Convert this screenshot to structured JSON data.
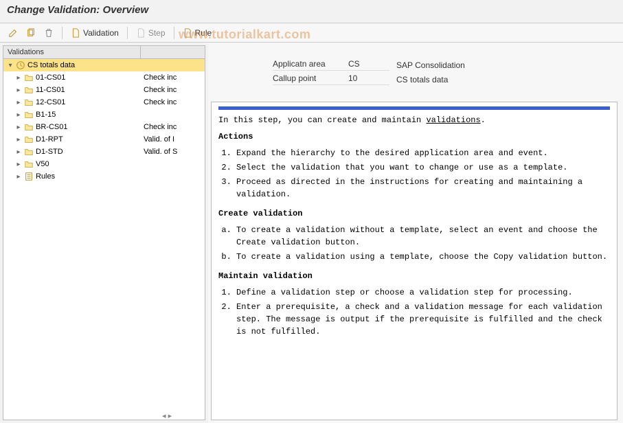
{
  "header": {
    "title": "Change Validation: Overview"
  },
  "watermark": "www.tutorialkart.com",
  "toolbar": {
    "validation_label": "Validation",
    "step_label": "Step",
    "rule_label": "Rule"
  },
  "tree": {
    "col1": "Validations",
    "col2": "",
    "root": {
      "label": "CS totals data",
      "desc": ""
    },
    "items": [
      {
        "label": "01-CS01",
        "desc": "Check inc"
      },
      {
        "label": "11-CS01",
        "desc": "Check inc"
      },
      {
        "label": "12-CS01",
        "desc": "Check inc"
      },
      {
        "label": "B1-15",
        "desc": ""
      },
      {
        "label": "BR-CS01",
        "desc": "Check inc"
      },
      {
        "label": "D1-RPT",
        "desc": "Valid. of I"
      },
      {
        "label": "D1-STD",
        "desc": "Valid. of S"
      },
      {
        "label": "V50",
        "desc": ""
      }
    ],
    "rules_label": "Rules"
  },
  "info": {
    "row1": {
      "label": "Applicatn area",
      "val1": "CS",
      "val2": "SAP Consolidation"
    },
    "row2": {
      "label": "Callup point",
      "val1": "10",
      "val2": "CS totals data"
    }
  },
  "help": {
    "intro_pre": "In this step, you can create and maintain ",
    "intro_link": "validations",
    "intro_post": ".",
    "h_actions": "Actions",
    "actions": [
      "Expand the hierarchy to the desired application area and event.",
      "Select the validation that you want to change or use as a template.",
      "Proceed as directed in the instructions for creating and maintaining a validation."
    ],
    "h_create": "Create validation",
    "create": [
      "To create a validation without a template, select an event and choose the Create validation button.",
      "To create a validation using a template, choose the Copy validation button."
    ],
    "h_maintain": "Maintain validation",
    "maintain": [
      "Define a validation step or choose a validation step for processing.",
      "Enter a prerequisite, a check and a validation message for each validation step. The message is output if the prerequisite is fulfilled and the check is not fulfilled."
    ]
  }
}
